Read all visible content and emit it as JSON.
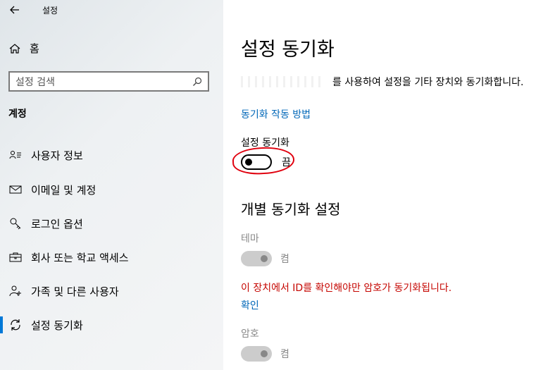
{
  "window": {
    "title": "설정",
    "back_icon": "back-arrow-icon"
  },
  "sidebar": {
    "home_label": "홈",
    "search": {
      "placeholder": "설정 검색"
    },
    "section": "계정",
    "items": [
      {
        "label": "사용자 정보",
        "icon": "user-info-icon",
        "active": false
      },
      {
        "label": "이메일 및 계정",
        "icon": "mail-icon",
        "active": false
      },
      {
        "label": "로그인 옵션",
        "icon": "key-icon",
        "active": false
      },
      {
        "label": "회사 또는 학교 액세스",
        "icon": "briefcase-icon",
        "active": false
      },
      {
        "label": "가족 및 다른 사용자",
        "icon": "family-icon",
        "active": false
      },
      {
        "label": "설정 동기화",
        "icon": "sync-icon",
        "active": true
      }
    ]
  },
  "main": {
    "title": "설정 동기화",
    "description": "를 사용하여 설정을 기타 장치와 동기화합니다.",
    "how_link": "동기화 작동 방법",
    "sync_settings": {
      "label": "설정 동기화",
      "state": "끔",
      "on": false
    },
    "individual_title": "개별 동기화 설정",
    "theme": {
      "label": "테마",
      "state": "켬",
      "on": true,
      "enabled": false
    },
    "warning": "이 장치에서 ID를 확인해야만 암호가 동기화됩니다.",
    "verify_link": "확인",
    "password": {
      "label": "암호",
      "state": "켬",
      "on": true,
      "enabled": false
    }
  },
  "colors": {
    "accent": "#0078d7",
    "link": "#0067b8",
    "warning": "#c50500",
    "annotation": "#e0000e"
  }
}
